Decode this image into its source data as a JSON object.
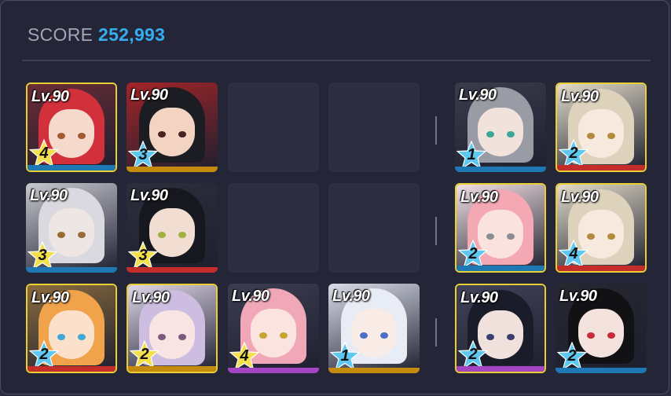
{
  "score": {
    "label": "SCORE",
    "value": "252,993"
  },
  "colors": {
    "accent": "#35aef0",
    "gold_border": "#e9cf34",
    "star_yellow": "#f4e04a",
    "star_blue": "#5dc8f0",
    "bar_blue": "#1e78b4",
    "bar_gold": "#c58b0e",
    "bar_red": "#c52d2a",
    "bar_purple": "#a446c4"
  },
  "left_grid": [
    {
      "level": "Lv.90",
      "stars": "4",
      "star_color": "yellow",
      "bar": "blue",
      "gold": true,
      "hair": "#d2303a",
      "skin": "#f5d9cc",
      "bg": "#6b2c35",
      "eye": "#a65a32"
    },
    {
      "level": "Lv.90",
      "stars": "3",
      "star_color": "blue",
      "bar": "gold",
      "gold": false,
      "hair": "#1c1d22",
      "skin": "#f3d3c2",
      "bg": "#a32428",
      "eye": "#4a2020"
    },
    null,
    null,
    {
      "level": "Lv.90",
      "stars": "3",
      "star_color": "yellow",
      "bar": "blue",
      "gold": false,
      "hair": "#d9d9df",
      "skin": "#ede6e4",
      "bg": "#c8c8cf",
      "eye": "#9a6a35"
    },
    {
      "level": "Lv.90",
      "stars": "3",
      "star_color": "yellow",
      "bar": "red",
      "gold": false,
      "hair": "#17181f",
      "skin": "#f1ddd2",
      "bg": "#2d2e3b",
      "eye": "#9fb23a"
    },
    null,
    null,
    {
      "level": "Lv.90",
      "stars": "2",
      "star_color": "blue",
      "bar": "red",
      "gold": true,
      "hair": "#f0a34a",
      "skin": "#fbe0cc",
      "bg": "#8a6b3d",
      "eye": "#3ca8d8"
    },
    {
      "level": "Lv.90",
      "stars": "2",
      "star_color": "yellow",
      "bar": "gold",
      "gold": true,
      "hair": "#cdbde0",
      "skin": "#f8e4e2",
      "bg": "#dfd7e7",
      "eye": "#7b5a7d"
    },
    {
      "level": "Lv.90",
      "stars": "4",
      "star_color": "yellow",
      "bar": "purple",
      "gold": false,
      "hair": "#f0a8b8",
      "skin": "#fbe4df",
      "bg": "#3c3d51",
      "eye": "#c7a430"
    },
    {
      "level": "Lv.90",
      "stars": "1",
      "star_color": "blue",
      "bar": "gold",
      "gold": false,
      "hair": "#e8ecf4",
      "skin": "#f9ebe6",
      "bg": "#d9dde8",
      "eye": "#4a6fc9"
    }
  ],
  "right_grid": [
    {
      "level": "Lv.90",
      "stars": "1",
      "star_color": "blue",
      "bar": "blue",
      "gold": false,
      "hair": "#9a9ca5",
      "skin": "#f2e2dc",
      "bg": "#3a3b4c",
      "eye": "#3aa79a"
    },
    {
      "level": "Lv.90",
      "stars": "2",
      "star_color": "blue",
      "bar": "red",
      "gold": true,
      "hair": "#ddd3bd",
      "skin": "#f6e9dd",
      "bg": "#e3dcc9",
      "eye": "#b38a3a"
    },
    {
      "level": "Lv.90",
      "stars": "2",
      "star_color": "blue",
      "bar": "blue",
      "gold": true,
      "hair": "#f3a8b3",
      "skin": "#fae3df",
      "bg": "#f2e0e3",
      "eye": "#8a8d95"
    },
    {
      "level": "Lv.90",
      "stars": "4",
      "star_color": "blue",
      "bar": "red",
      "gold": true,
      "hair": "#ddd3bd",
      "skin": "#f6e9dd",
      "bg": "#e3dcc9",
      "eye": "#b38a3a"
    },
    {
      "level": "Lv.90",
      "stars": "2",
      "star_color": "blue",
      "bar": "purple",
      "gold": true,
      "hair": "#1b1c2a",
      "skin": "#f1e1dd",
      "bg": "#42435a",
      "eye": "#3a3e6e"
    },
    {
      "level": "Lv.90",
      "stars": "2",
      "star_color": "blue",
      "bar": "blue",
      "gold": false,
      "hair": "#121215",
      "skin": "#f3e2de",
      "bg": "#26272f",
      "eye": "#c82a3a"
    }
  ]
}
